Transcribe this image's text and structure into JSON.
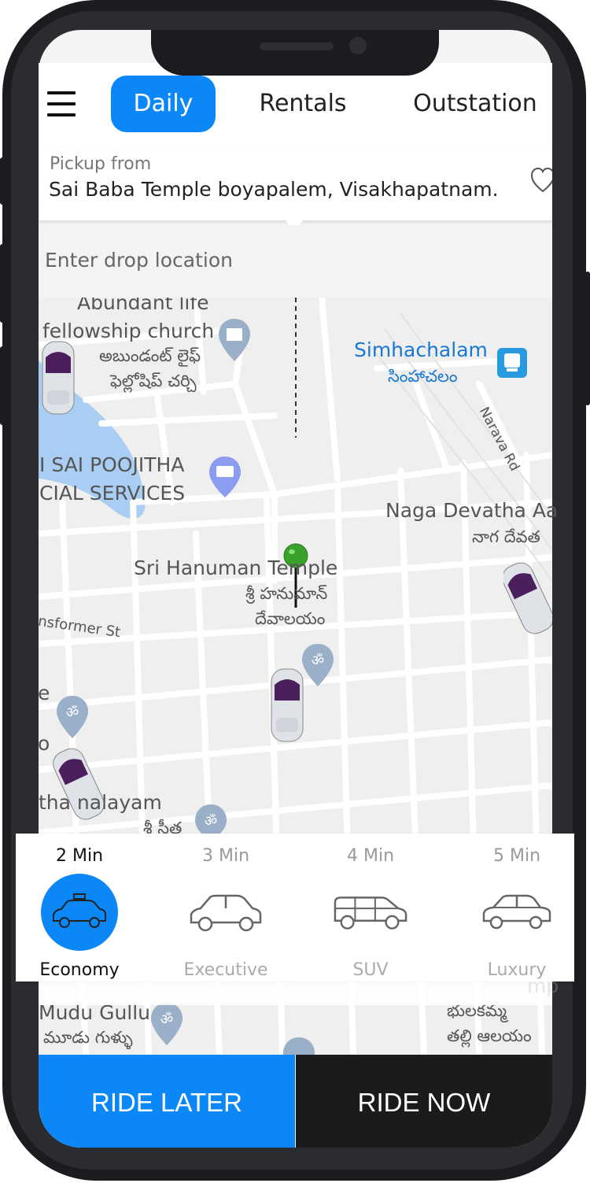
{
  "tabs": [
    "Daily",
    "Rentals",
    "Outstation"
  ],
  "active_tab": "Daily",
  "pickup": {
    "label": "Pickup from",
    "address": "Sai Baba Temple boyapalem, Visakhapatnam."
  },
  "drop": {
    "placeholder": "Enter drop location"
  },
  "map_labels": {
    "abundant_1": "Abundant life",
    "abundant_2": "fellowship church",
    "abundant_te1": "అబుండంట్ లైఫ్",
    "abundant_te2": "ఫెల్లోషిప్ చర్చి",
    "simhachalam": "Simhachalam",
    "simhachalam_te": "సింహాచలం",
    "narava": "Narava Rd",
    "sai_1": "I SAI POOJITHA",
    "sai_2": "CIAL SERVICES",
    "naga": "Naga Devatha Aa",
    "naga_te": "నాగ దేవత",
    "hanuman": "Sri Hanuman Temple",
    "hanuman_te1": "శ్రీ హనుమాన్",
    "hanuman_te2": "దేవాలయం",
    "transformer": "nsformer St",
    "e_char": "e",
    "o_char": "o",
    "alayam": "tha  nalayam",
    "seetha_te": "శ్రీ సీత",
    "mudu": "Mudu Gullu",
    "mudu_te": "మూడు గుళ్ళు",
    "bhula": "భులకమ్మ",
    "bhula_te2": "తల్లి ఆలయం",
    "mp": "mp"
  },
  "vehicles": [
    {
      "eta": "2 Min",
      "name": "Economy",
      "selected": true
    },
    {
      "eta": "3 Min",
      "name": "Executive",
      "selected": false
    },
    {
      "eta": "4 Min",
      "name": "SUV",
      "selected": false
    },
    {
      "eta": "5 Min",
      "name": "Luxury",
      "selected": false
    }
  ],
  "actions": {
    "ride_later": "RIDE LATER",
    "ride_now": "RIDE NOW"
  },
  "colors": {
    "accent": "#0b87f7",
    "dark": "#1b1b1b",
    "pin": "#3aa12a",
    "car_roof": "#4a1f5c"
  },
  "icons": [
    "menu-icon",
    "heart-icon",
    "map-pin-icon",
    "hospital-icon",
    "hotel-icon",
    "temple-icon",
    "train-icon",
    "taxi-icon",
    "sedan-icon",
    "suv-icon",
    "hatchback-icon"
  ]
}
